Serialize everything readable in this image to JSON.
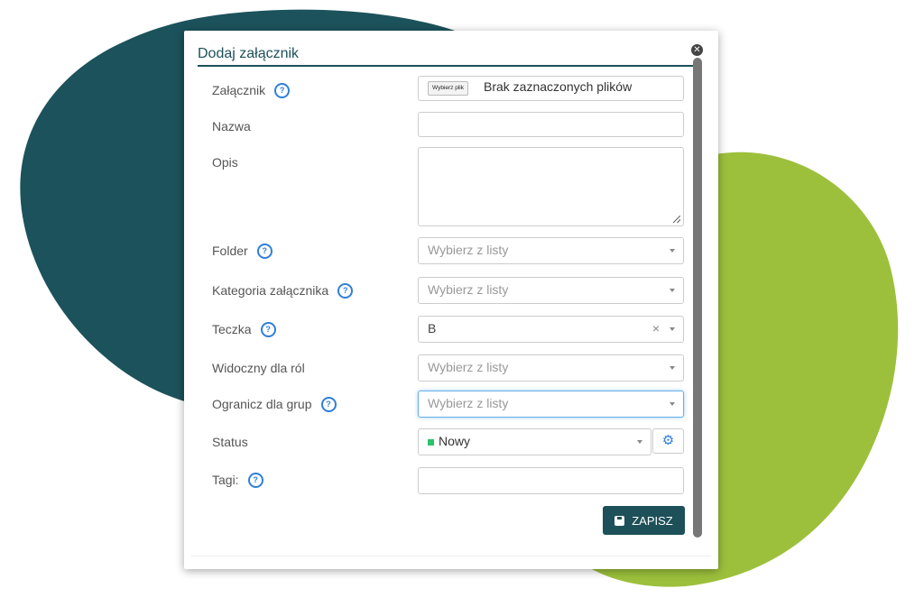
{
  "colors": {
    "dark_blob": "#1c525b",
    "green_blob": "#9cc03c",
    "accent": "#1d5059",
    "help_blue": "#2f7fd8",
    "status_green": "#2cc36b"
  },
  "dialog": {
    "title": "Dodaj załącznik",
    "close_icon": "close-icon"
  },
  "form": {
    "attachment": {
      "label": "Załącznik",
      "file_button": "Wybierz plik",
      "file_text": "Brak zaznaczonych plików"
    },
    "name": {
      "label": "Nazwa",
      "value": ""
    },
    "description": {
      "label": "Opis",
      "value": ""
    },
    "folder": {
      "label": "Folder",
      "placeholder": "Wybierz z listy"
    },
    "category": {
      "label": "Kategoria załącznika",
      "placeholder": "Wybierz z listy"
    },
    "folder_case": {
      "label": "Teczka",
      "value": "B",
      "clear": "×"
    },
    "visible_for_roles": {
      "label": "Widoczny dla ról",
      "placeholder": "Wybierz z listy"
    },
    "restrict_groups": {
      "label": "Ogranicz dla grup",
      "placeholder": "Wybierz z listy"
    },
    "status": {
      "label": "Status",
      "value": "Nowy",
      "gear_icon": "gear-icon"
    },
    "tags": {
      "label": "Tagi:",
      "value": ""
    }
  },
  "actions": {
    "save_label": "ZAPISZ",
    "save_icon": "save-icon"
  },
  "help_glyph": "?"
}
